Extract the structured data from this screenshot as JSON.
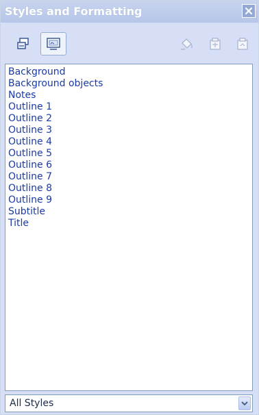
{
  "window": {
    "title": "Styles and Formatting"
  },
  "toolbar": {
    "buttons": [
      {
        "icon": "drawing-styles-icon",
        "active": false
      },
      {
        "icon": "presentation-styles-icon",
        "active": true
      },
      {
        "icon": "fill-format-mode-icon",
        "active": false
      },
      {
        "icon": "new-style-from-selection-icon",
        "active": false
      },
      {
        "icon": "update-style-icon",
        "active": false
      }
    ]
  },
  "styles_list": {
    "items": [
      "Background",
      "Background objects",
      "Notes",
      "Outline 1",
      "Outline 2",
      "Outline 3",
      "Outline 4",
      "Outline 5",
      "Outline 6",
      "Outline 7",
      "Outline 8",
      "Outline 9",
      "Subtitle",
      "Title"
    ]
  },
  "filter": {
    "selected": "All Styles"
  },
  "colors": {
    "panel_bg": "#d6dff5",
    "title_bg": "#b6c6e8",
    "item_text": "#1a3aa6",
    "list_border": "#7f9db9"
  }
}
